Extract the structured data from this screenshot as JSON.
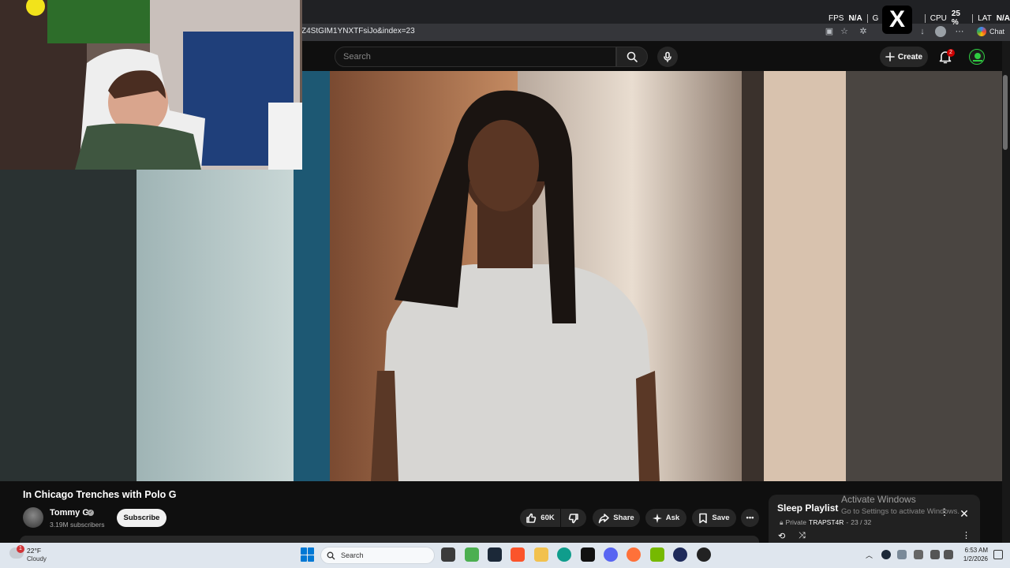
{
  "browser": {
    "url": "Z4StGIM1YNXTFsiJo&index=23",
    "chat_label": "Chat"
  },
  "overlay_stats": {
    "fps_label": "FPS",
    "fps_value": "N/A",
    "gpu_label": "G",
    "cpu_label": "CPU",
    "cpu_value": "25 %",
    "lat_label": "LAT",
    "lat_value": "N/A",
    "x_logo": "X"
  },
  "youtube": {
    "search_placeholder": "Search",
    "create_label": "Create",
    "notification_count": "2",
    "avatar_text": "TRAPST4R"
  },
  "video": {
    "title": "In Chicago Trenches with Polo G",
    "channel": "Tommy G",
    "subscribers": "3.19M subscribers",
    "subscribe_label": "Subscribe",
    "likes": "60K",
    "share_label": "Share",
    "ask_label": "Ask",
    "save_label": "Save"
  },
  "playlist": {
    "title": "Sleep Playlist",
    "privacy": "Private",
    "owner": "TRAPST4R",
    "position": "23 / 32"
  },
  "watermark": {
    "line1": "Activate Windows",
    "line2": "Go to Settings to activate Windows."
  },
  "taskbar": {
    "weather_alerts": "1",
    "temperature": "22°F",
    "condition": "Cloudy",
    "search_label": "Search",
    "time": "6:53 AM",
    "date": "1/2/2026"
  },
  "colors": {
    "youtube_bg": "#0f0f0f",
    "accent_red": "#cc0000",
    "windows_blue": "#0078d4"
  }
}
